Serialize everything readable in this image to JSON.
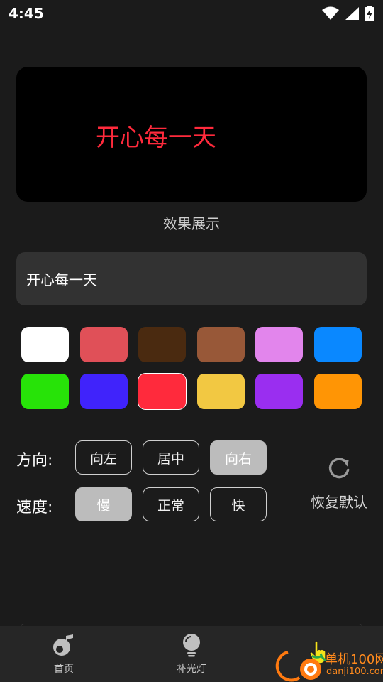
{
  "status_bar": {
    "time": "4:45",
    "icons": [
      "wifi-icon",
      "signal-icon",
      "battery-charging-icon"
    ]
  },
  "preview": {
    "text": "开心每一天",
    "text_color": "#ff2a3c",
    "background": "#000000",
    "caption": "效果展示"
  },
  "input": {
    "value": "开心每一天"
  },
  "colors": [
    {
      "hex": "#ffffff",
      "selected": false
    },
    {
      "hex": "#e05058",
      "selected": false
    },
    {
      "hex": "#4a2a10",
      "selected": false
    },
    {
      "hex": "#985838",
      "selected": false
    },
    {
      "hex": "#e285ec",
      "selected": false
    },
    {
      "hex": "#0a88ff",
      "selected": false
    },
    {
      "hex": "#27e308",
      "selected": false
    },
    {
      "hex": "#4023fb",
      "selected": false
    },
    {
      "hex": "#ff2a3c",
      "selected": true
    },
    {
      "hex": "#f2c842",
      "selected": false
    },
    {
      "hex": "#9a2ef0",
      "selected": false
    },
    {
      "hex": "#ff9505",
      "selected": false
    }
  ],
  "direction": {
    "label": "方向:",
    "options": [
      "向左",
      "居中",
      "向右"
    ],
    "selected": "向右"
  },
  "speed": {
    "label": "速度:",
    "options": [
      "慢",
      "正常",
      "快"
    ],
    "selected": "慢"
  },
  "reset": {
    "label": "恢复默认",
    "icon": "refresh-icon"
  },
  "tabs": [
    {
      "label": "首页",
      "icon": "music-note-icon"
    },
    {
      "label": "补光灯",
      "icon": "lightbulb-icon"
    },
    {
      "label": "",
      "icon": "hand-pointer-icon"
    }
  ],
  "watermark": {
    "title": "单机100网",
    "url": "danji100.com"
  }
}
